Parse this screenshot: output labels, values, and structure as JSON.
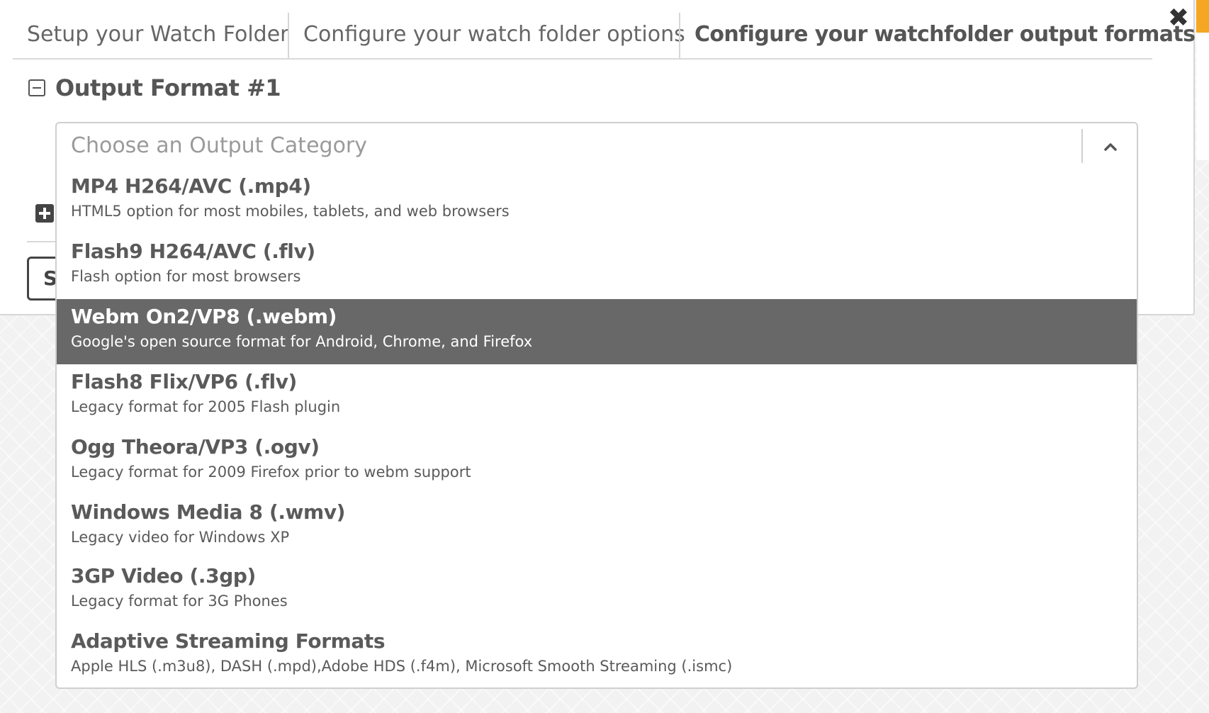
{
  "tabs": [
    {
      "label": "Setup your Watch Folder"
    },
    {
      "label": "Configure your watch folder options"
    },
    {
      "label": "Configure your watchfolder output formats"
    }
  ],
  "close_icon": "close-icon",
  "section": {
    "title": "Output Format #1"
  },
  "select": {
    "placeholder": "Choose an Output Category"
  },
  "hidden_button": {
    "label": "S"
  },
  "options": [
    {
      "name": "MP4 H264/AVC (.mp4)",
      "desc": "HTML5 option for most mobiles, tablets, and web browsers",
      "selected": false
    },
    {
      "name": "Flash9 H264/AVC (.flv)",
      "desc": "Flash option for most browsers",
      "selected": false
    },
    {
      "name": "Webm On2/VP8 (.webm)",
      "desc": "Google's open source format for Android, Chrome, and Firefox",
      "selected": true
    },
    {
      "name": "Flash8 Flix/VP6 (.flv)",
      "desc": "Legacy format for 2005 Flash plugin",
      "selected": false
    },
    {
      "name": "Ogg Theora/VP3 (.ogv)",
      "desc": "Legacy format for 2009 Firefox prior to webm support",
      "selected": false
    },
    {
      "name": "Windows Media 8 (.wmv)",
      "desc": "Legacy video for Windows XP",
      "selected": false
    },
    {
      "name": "3GP Video (.3gp)",
      "desc": "Legacy format for 3G Phones",
      "selected": false
    },
    {
      "name": "Adaptive Streaming Formats",
      "desc": "Apple HLS (.m3u8), DASH (.mpd),Adobe HDS (.f4m), Microsoft Smooth Streaming (.ismc)",
      "selected": false
    }
  ],
  "colors": {
    "selected_bg": "#686868",
    "accent": "#f5a623"
  }
}
